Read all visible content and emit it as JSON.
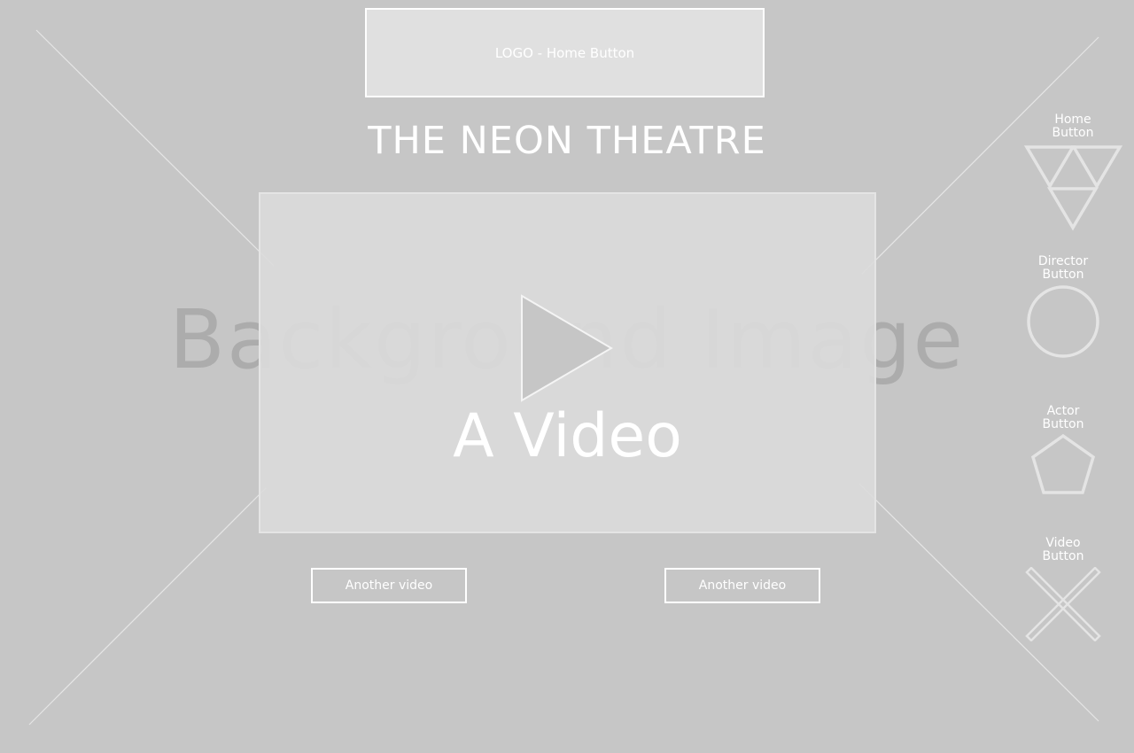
{
  "background": {
    "label": "Background Image"
  },
  "header": {
    "logo_label": "LOGO - Home Button",
    "title": "THE NEON THEATRE"
  },
  "main_video": {
    "label": "A Video",
    "icon": "play-icon"
  },
  "related_videos": [
    {
      "label": "Another video"
    },
    {
      "label": "Another video"
    }
  ],
  "side_nav": {
    "home": {
      "label_line1": "Home",
      "label_line2": "Button",
      "icon": "triangles-icon"
    },
    "director": {
      "label_line1": "Director",
      "label_line2": "Button",
      "icon": "circle-icon"
    },
    "actor": {
      "label_line1": "Actor",
      "label_line2": "Button",
      "icon": "pentagon-icon"
    },
    "video": {
      "label_line1": "Video",
      "label_line2": "Button",
      "icon": "x-icon"
    }
  },
  "colors": {
    "background": "#c6c6c6",
    "text": "#ffffff",
    "placeholder_fill": "#e0e0e0",
    "icon_stroke": "#e0e0e0"
  }
}
